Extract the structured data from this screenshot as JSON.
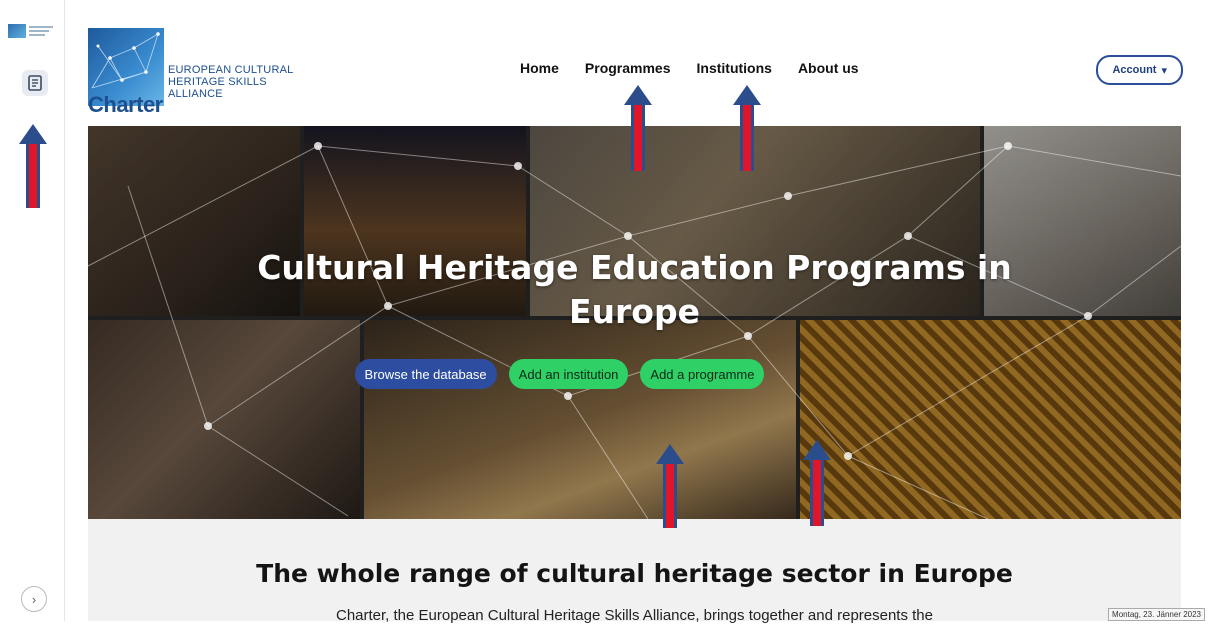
{
  "logo": {
    "wordmark": "Charter",
    "subtitle_lines": [
      "EUROPEAN CULTURAL",
      "HERITAGE SKILLS",
      "ALLIANCE"
    ]
  },
  "nav": {
    "items": [
      "Home",
      "Programmes",
      "Institutions",
      "About us"
    ]
  },
  "account": {
    "label": "Account"
  },
  "hero": {
    "title_line1": "Cultural Heritage Education Programs in",
    "title_line2": "Europe",
    "buttons": {
      "browse": "Browse the database",
      "add_institution": "Add an institution",
      "add_programme": "Add a programme"
    }
  },
  "section": {
    "title": "The whole range of cultural heritage sector in Europe",
    "intro": "Charter, the European Cultural Heritage Skills Alliance, brings together and represents the"
  },
  "system": {
    "date_tooltip": "Montag, 23. Jänner 2023"
  },
  "colors": {
    "brand_blue": "#1e4f8f",
    "button_blue": "#2d4ea0",
    "button_green": "#2fd066",
    "arrow_red": "#e0152a"
  }
}
